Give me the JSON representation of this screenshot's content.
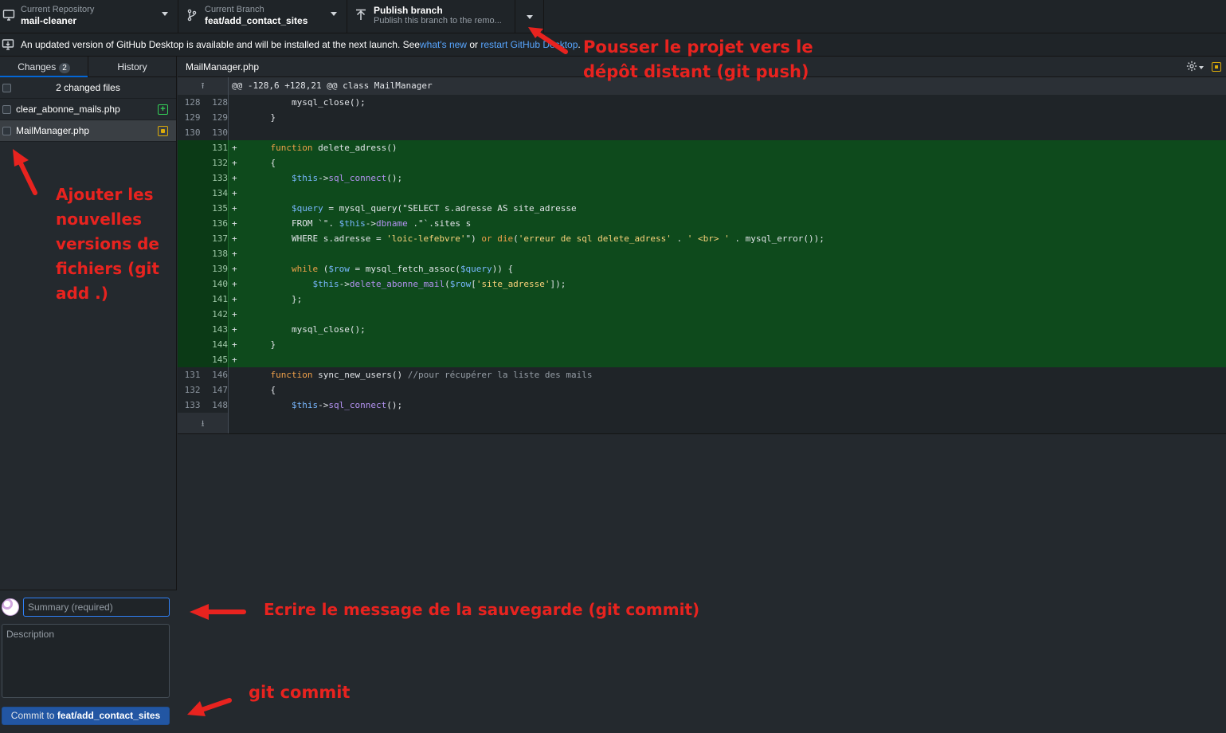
{
  "toolbar": {
    "repo_caption": "Current Repository",
    "repo_name": "mail-cleaner",
    "branch_caption": "Current Branch",
    "branch_name": "feat/add_contact_sites",
    "publish_title": "Publish branch",
    "publish_desc": "Publish this branch to the remo..."
  },
  "banner": {
    "text_before": "An updated version of GitHub Desktop is available and will be installed at the next launch. See ",
    "link1": "what's new",
    "text_mid": " or ",
    "link2": "restart GitHub Desktop",
    "text_after": "."
  },
  "sidebar": {
    "tab_changes": "Changes",
    "changes_count": "2",
    "tab_history": "History",
    "changed_files_label": "2 changed files",
    "files": [
      {
        "name": "clear_abonne_mails.php",
        "status": "added"
      },
      {
        "name": "MailManager.php",
        "status": "modified"
      }
    ],
    "summary_placeholder": "Summary (required)",
    "description_placeholder": "Description",
    "commit_prefix": "Commit to ",
    "commit_branch": "feat/add_contact_sites"
  },
  "diff": {
    "file_name": "MailManager.php",
    "hunk": "@@ -128,6 +128,21 @@ class MailManager",
    "lines": [
      {
        "type": "ctx",
        "old": "128",
        "new": "128",
        "marker": "",
        "code": "        mysql_close();"
      },
      {
        "type": "ctx",
        "old": "129",
        "new": "129",
        "marker": "",
        "code": "    }"
      },
      {
        "type": "ctx",
        "old": "130",
        "new": "130",
        "marker": "",
        "code": ""
      },
      {
        "type": "add",
        "old": "",
        "new": "131",
        "marker": "+",
        "code": "    function delete_adress()"
      },
      {
        "type": "add",
        "old": "",
        "new": "132",
        "marker": "+",
        "code": "    {"
      },
      {
        "type": "add",
        "old": "",
        "new": "133",
        "marker": "+",
        "code": "        $this->sql_connect();"
      },
      {
        "type": "add",
        "old": "",
        "new": "134",
        "marker": "+",
        "code": ""
      },
      {
        "type": "add",
        "old": "",
        "new": "135",
        "marker": "+",
        "code": "        $query = mysql_query(\"SELECT s.adresse AS site_adresse"
      },
      {
        "type": "add",
        "old": "",
        "new": "136",
        "marker": "+",
        "code": "        FROM `\". $this->dbname .\"`.sites s"
      },
      {
        "type": "add",
        "old": "",
        "new": "137",
        "marker": "+",
        "code": "        WHERE s.adresse = 'loic-lefebvre'\") or die('erreur de sql delete_adress' . ' <br> ' . mysql_error());"
      },
      {
        "type": "add",
        "old": "",
        "new": "138",
        "marker": "+",
        "code": ""
      },
      {
        "type": "add",
        "old": "",
        "new": "139",
        "marker": "+",
        "code": "        while ($row = mysql_fetch_assoc($query)) {"
      },
      {
        "type": "add",
        "old": "",
        "new": "140",
        "marker": "+",
        "code": "            $this->delete_abonne_mail($row['site_adresse']);"
      },
      {
        "type": "add",
        "old": "",
        "new": "141",
        "marker": "+",
        "code": "        };"
      },
      {
        "type": "add",
        "old": "",
        "new": "142",
        "marker": "+",
        "code": ""
      },
      {
        "type": "add",
        "old": "",
        "new": "143",
        "marker": "+",
        "code": "        mysql_close();"
      },
      {
        "type": "add",
        "old": "",
        "new": "144",
        "marker": "+",
        "code": "    }"
      },
      {
        "type": "add",
        "old": "",
        "new": "145",
        "marker": "+",
        "code": ""
      },
      {
        "type": "ctx",
        "old": "131",
        "new": "146",
        "marker": "",
        "code": "    function sync_new_users() //pour récupérer la liste des mails"
      },
      {
        "type": "ctx",
        "old": "132",
        "new": "147",
        "marker": "",
        "code": "    {"
      },
      {
        "type": "ctx",
        "old": "133",
        "new": "148",
        "marker": "",
        "code": "        $this->sql_connect();"
      }
    ]
  },
  "annotations": {
    "push": [
      "Pousser le projet vers le",
      "dépôt distant (git push)"
    ],
    "add": [
      "Ajouter les",
      "nouvelles",
      "versions de",
      "fichiers (git",
      "add .)"
    ],
    "commit_msg": "Ecrire le message de la sauvegarde (git commit)",
    "commit": "git commit",
    "color": "#e8231f"
  },
  "colors": {
    "added_bg": "#0e4a1c",
    "accent": "#0366d6",
    "modified": "#dbab0a",
    "added": "#34d058"
  }
}
